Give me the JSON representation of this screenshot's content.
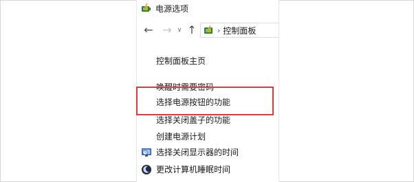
{
  "window": {
    "title": "电源选项",
    "title_icon": "power-options-icon"
  },
  "nav": {
    "back_icon": "←",
    "forward_icon": "→",
    "dropdown_icon": "∨",
    "up_icon": "↑",
    "address_separator": "›",
    "address_text": "控制面板"
  },
  "sidebar": {
    "links": [
      {
        "label": "控制面板主页"
      },
      {
        "label": "唤醒时需要密码"
      },
      {
        "label": "选择电源按钮的功能"
      },
      {
        "label": "选择关闭盖子的功能"
      },
      {
        "label": "创建电源计划"
      }
    ],
    "icon_links": [
      {
        "label": "选择关闭显示器的时间",
        "icon": "display-timer-icon"
      },
      {
        "label": "更改计算机睡眠时间",
        "icon": "moon-sleep-icon"
      }
    ]
  },
  "colors": {
    "highlight": "#e03a3a",
    "border": "#d6d6d6"
  }
}
